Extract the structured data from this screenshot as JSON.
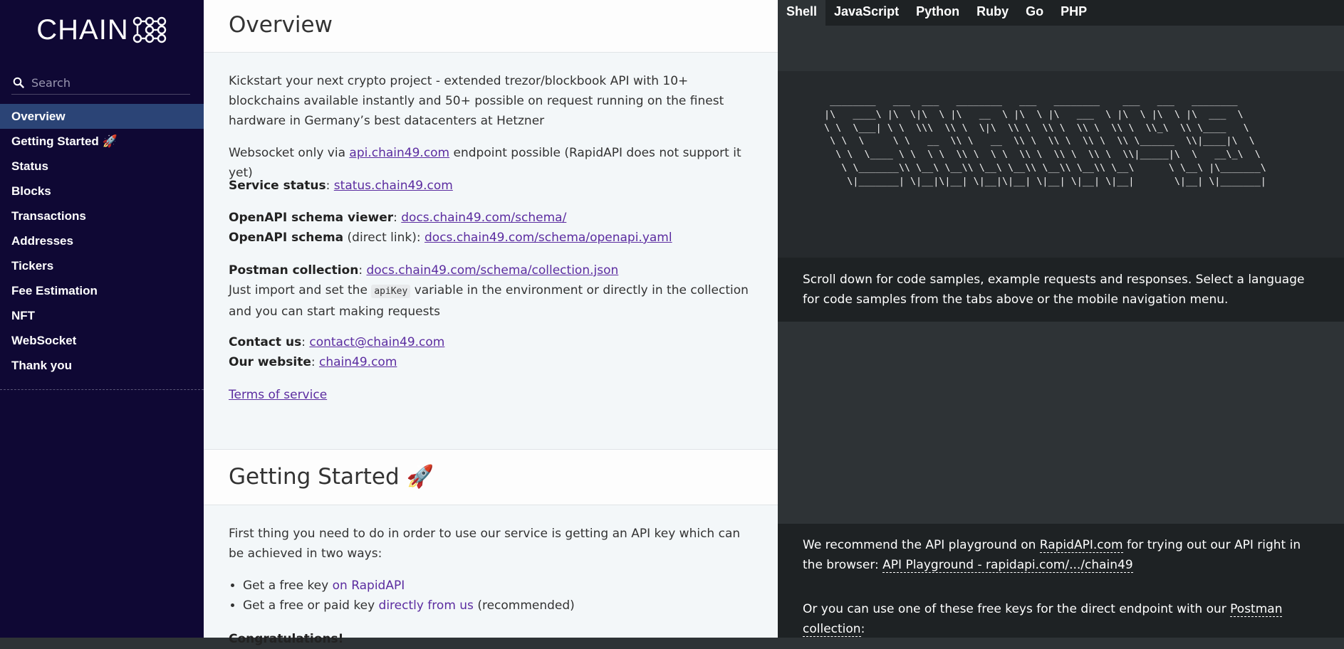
{
  "sidebar": {
    "logo_text": "CHAIN",
    "search_placeholder": "Search",
    "items": [
      {
        "label": "Overview",
        "active": true
      },
      {
        "label": "Getting Started 🚀"
      },
      {
        "label": "Status"
      },
      {
        "label": "Blocks"
      },
      {
        "label": "Transactions"
      },
      {
        "label": "Addresses"
      },
      {
        "label": "Tickers"
      },
      {
        "label": "Fee Estimation"
      },
      {
        "label": "NFT"
      },
      {
        "label": "WebSocket"
      },
      {
        "label": "Thank you"
      }
    ]
  },
  "overview": {
    "title": "Overview",
    "intro": "Kickstart your next crypto project - extended trezor/blockbook API with 10+ blockchains available instantly and 50+ possible on request running on the finest hardware in Germany’s best datacenters at Hetzner",
    "ws_prefix": "Websocket only via ",
    "ws_link": "api.chain49.com",
    "ws_suffix": " endpoint possible (RapidAPI does not support it yet)",
    "status_label": "Service status",
    "status_link": "status.chain49.com",
    "schema_viewer_label": "OpenAPI schema viewer",
    "schema_viewer_link": "docs.chain49.com/schema/",
    "schema_label": "OpenAPI schema",
    "schema_note": " (direct link): ",
    "schema_link": "docs.chain49.com/schema/openapi.yaml",
    "postman_label": "Postman collection",
    "postman_link": "docs.chain49.com/schema/collection.json",
    "import_prefix": "Just import and set the ",
    "import_code": "apiKey",
    "import_suffix": " variable in the environment or directly in the collection and you can start making requests",
    "contact_label": "Contact us",
    "contact_link": "contact@chain49.com",
    "website_label": "Our website",
    "website_link": "chain49.com",
    "terms_link": "Terms of service"
  },
  "getting_started": {
    "title": "Getting Started 🚀",
    "intro": "First thing you need to do in order to use our service is getting an API key which can be achieved in two ways:",
    "bullet1_prefix": "Get a free key ",
    "bullet1_link": "on RapidAPI",
    "bullet2_prefix": "Get a free or paid key ",
    "bullet2_link": "directly from us",
    "bullet2_suffix": " (recommended)",
    "next_heading": "Congratulations!"
  },
  "code_panel": {
    "tabs": [
      "Shell",
      "JavaScript",
      "Python",
      "Ruby",
      "Go",
      "PHP"
    ],
    "active_tab": "Shell",
    "ascii_art": "  ________   ___  ___   ________   ___   ________    ___   ___   ________\n |\\   ____\\ |\\  \\|\\  \\ |\\   __  \\ |\\  \\ |\\   ___  \\ |\\  \\ |\\  \\ |\\  ___  \\\n \\ \\  \\___| \\ \\  \\\\\\  \\\\ \\  \\|\\  \\\\ \\  \\\\ \\  \\\\ \\  \\\\ \\  \\\\_\\  \\\\ \\____   \\\n  \\ \\  \\     \\ \\   __  \\\\ \\   __  \\\\ \\  \\\\ \\  \\\\ \\  \\\\ \\______  \\\\|____|\\  \\\n   \\ \\  \\____ \\ \\  \\ \\  \\\\ \\  \\ \\  \\\\ \\  \\\\ \\  \\\\ \\  \\\\|_____|\\  \\   __\\_\\  \\\n    \\ \\_______\\\\ \\__\\ \\__\\\\ \\__\\ \\__\\\\ \\__\\\\ \\__\\\\ \\__\\      \\ \\__\\ |\\_______\\\n     \\|_______| \\|__|\\|__| \\|__|\\|__| \\|__| \\|__| \\|__|       \\|__| \\|_______|",
    "note1": "Scroll down for code samples, example requests and responses. Select a language for code samples from the tabs above or the mobile navigation menu.",
    "note2_prefix": "We recommend the API playground on ",
    "note2_link1": "RapidAPI.com",
    "note2_mid": " for trying out our API right in the browser: ",
    "note2_link2": "API Playground - rapidapi.com/.../chain49",
    "note3_prefix": "Or you can use one of these free keys for the direct endpoint with our ",
    "note3_link": "Postman collection",
    "note3_suffix": ":"
  }
}
